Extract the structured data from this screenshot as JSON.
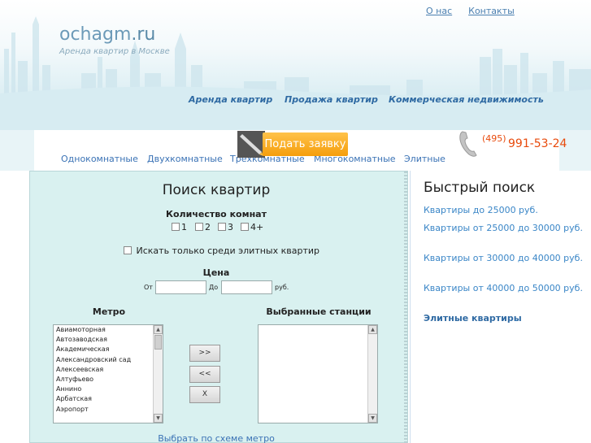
{
  "header": {
    "top_links": [
      "О нас",
      "Контакты"
    ],
    "logo_main": "ochagm",
    "logo_suffix": ".ru",
    "tagline": "Аренда квартир в Москве",
    "main_nav": [
      "Аренда квартир",
      "Продажа квартир",
      "Коммерческая недвижимость"
    ]
  },
  "submit_button": {
    "label": "Подать заявку"
  },
  "phone": {
    "code": "(495)",
    "number": "991-53-24"
  },
  "tabs": [
    "Однокомнатные",
    "Двухкомнатные",
    "Трехкомнатные",
    "Многокомнатные",
    "Элитные"
  ],
  "search": {
    "title": "Поиск квартир",
    "rooms_label": "Количество комнат",
    "rooms": [
      "1",
      "2",
      "3",
      "4+"
    ],
    "elite_label": "Искать только среди элитных квартир",
    "price_label": "Цена",
    "price_from": "От",
    "price_to": "До",
    "currency": "руб.",
    "metro_label": "Метро",
    "selected_label": "Выбранные станции",
    "metro_stations": [
      "Авиамоторная",
      "Автозаводская",
      "Академическая",
      "Александровский сад",
      "Алексеевская",
      "Алтуфьево",
      "Аннино",
      "Арбатская",
      "Аэропорт"
    ],
    "add_button": ">>",
    "remove_button": "<<",
    "clear_button": "X",
    "scheme_link": "Выбрать по схеме метро"
  },
  "quick_search": {
    "title": "Быстрый поиск",
    "links": [
      "Квартиры до 25000 руб.",
      "Квартиры от 25000 до 30000 руб.",
      "Квартиры от 30000 до 40000 руб.",
      "Квартиры от 40000 до 50000 руб."
    ],
    "elite_link": "Элитные квартиры",
    "elite_suffix": "."
  },
  "colors": {
    "link": "#3a72b5",
    "accent_orange": "#f59e0c",
    "phone": "#e84a0c",
    "panel_bg": "#d9f1f0"
  }
}
